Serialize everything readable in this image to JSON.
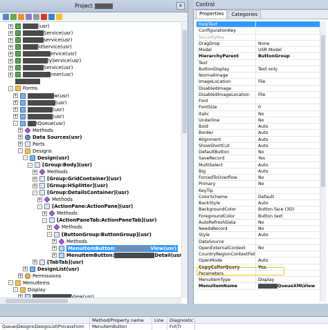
{
  "project_pane": {
    "title": "Project",
    "close_glyph": "x",
    "tree": [
      {
        "indent": 0,
        "exp": "+",
        "icon": "ic-class",
        "text": "(usr)",
        "pre": 22
      },
      {
        "indent": 0,
        "exp": "+",
        "icon": "ic-class",
        "text": "Service(usr)",
        "pre": 30
      },
      {
        "indent": 0,
        "exp": "+",
        "icon": "ic-class",
        "text": "service(usr)",
        "pre": 30
      },
      {
        "indent": 0,
        "exp": "+",
        "icon": "ic-class",
        "text": "ldService(usr)",
        "pre": 22
      },
      {
        "indent": 0,
        "exp": "+",
        "icon": "ic-class",
        "text": "ervice(usr)",
        "pre": 40
      },
      {
        "indent": 0,
        "exp": "+",
        "icon": "ic-class",
        "text": "lyService(usr)",
        "pre": 36
      },
      {
        "indent": 0,
        "exp": "+",
        "icon": "ic-class",
        "text": "Service(usr)",
        "pre": 30
      },
      {
        "indent": 0,
        "exp": "+",
        "icon": "ic-class",
        "text": "nner(usr)",
        "pre": 40
      },
      {
        "indent": 0,
        "exp": "",
        "icon": "",
        "text": "",
        "pre": 36
      },
      {
        "indent": 0,
        "exp": "-",
        "icon": "ic-folder",
        "text": "Forms",
        "pre": 0
      },
      {
        "indent": 1,
        "exp": "+",
        "icon": "ic-form",
        "text": "w(usr)",
        "pre": 38
      },
      {
        "indent": 1,
        "exp": "+",
        "icon": "ic-form",
        "text": "(usr)",
        "pre": 40
      },
      {
        "indent": 1,
        "exp": "+",
        "icon": "ic-form",
        "text": "(usr)",
        "pre": 36
      },
      {
        "indent": 1,
        "exp": "+",
        "icon": "ic-form",
        "text": "(usr)",
        "pre": 36
      },
      {
        "indent": 1,
        "exp": "-",
        "icon": "ic-form",
        "text": "tQueue(usr)",
        "pre": 12
      },
      {
        "indent": 2,
        "exp": "+",
        "icon": "ic-method",
        "text": "Methods",
        "pre": 0
      },
      {
        "indent": 2,
        "exp": "+",
        "icon": "ic-ds",
        "text": "Data Sources(usr)",
        "pre": 0,
        "bold": true
      },
      {
        "indent": 2,
        "exp": "+",
        "icon": "ic-group",
        "text": "Parts",
        "pre": 0
      },
      {
        "indent": 2,
        "exp": "-",
        "icon": "ic-folder",
        "text": "Designs",
        "pre": 0
      },
      {
        "indent": 3,
        "exp": "-",
        "icon": "ic-form",
        "text": "Design(usr)",
        "pre": 0,
        "bold": true
      },
      {
        "indent": 4,
        "exp": "-",
        "icon": "ic-group",
        "text": "[Group:Body](usr)",
        "pre": 0,
        "bold": true
      },
      {
        "indent": 5,
        "exp": "+",
        "icon": "ic-method",
        "text": "Methods",
        "pre": 0
      },
      {
        "indent": 5,
        "exp": "+",
        "icon": "ic-group",
        "text": "[Group:GridContainer](usr)",
        "pre": 0,
        "bold": true
      },
      {
        "indent": 5,
        "exp": "+",
        "icon": "ic-group",
        "text": "[Group:HSplitter](usr)",
        "pre": 0,
        "bold": true
      },
      {
        "indent": 5,
        "exp": "-",
        "icon": "ic-group",
        "text": "[Group:DetailsContainer](usr)",
        "pre": 0,
        "bold": true
      },
      {
        "indent": 6,
        "exp": "+",
        "icon": "ic-method",
        "text": "Methods",
        "pre": 0
      },
      {
        "indent": 6,
        "exp": "-",
        "icon": "ic-group",
        "text": "[ActionPane:ActionPane](usr)",
        "pre": 0,
        "bold": true
      },
      {
        "indent": 7,
        "exp": "+",
        "icon": "ic-method",
        "text": "Methods",
        "pre": 0
      },
      {
        "indent": 7,
        "exp": "-",
        "icon": "ic-group",
        "text": "[ActionPaneTab:ActionPaneTab](usr)",
        "pre": 0,
        "bold": true
      },
      {
        "indent": 8,
        "exp": "+",
        "icon": "ic-method",
        "text": "Methods",
        "pre": 0
      },
      {
        "indent": 8,
        "exp": "-",
        "icon": "ic-group",
        "text": "[ButtonGroup:ButtonGroup](usr)",
        "pre": 0,
        "bold": true
      },
      {
        "indent": 9,
        "exp": "+",
        "icon": "ic-method",
        "text": "Methods",
        "pre": 0
      },
      {
        "indent": 9,
        "exp": "+",
        "icon": "ic-button",
        "text": "MenuItemButton:",
        "post": "View(usr)",
        "redact": 50,
        "pre": 0,
        "bold": true,
        "selected": true
      },
      {
        "indent": 9,
        "exp": "+",
        "icon": "ic-button",
        "text": "MenuItemButton:",
        "post": "Detail(usr)",
        "redact": 58,
        "pre": 0,
        "bold": true
      },
      {
        "indent": 5,
        "exp": "+",
        "icon": "ic-group",
        "text": "[TabTab](usr)",
        "pre": 0,
        "bold": true
      },
      {
        "indent": 3,
        "exp": "+",
        "icon": "ic-form",
        "text": "DesignList(usr)",
        "pre": 0,
        "bold": true
      },
      {
        "indent": 2,
        "exp": "+",
        "icon": "ic-perm",
        "text": "Permissions",
        "pre": 0
      },
      {
        "indent": 0,
        "exp": "-",
        "icon": "ic-folder",
        "text": "MenuItems",
        "pre": 0
      },
      {
        "indent": 1,
        "exp": "-",
        "icon": "ic-folder",
        "text": "Display",
        "pre": 0
      },
      {
        "indent": 2,
        "exp": "+",
        "icon": "ic-button",
        "text": "View(usr)",
        "pre": 56
      }
    ]
  },
  "control_pane": {
    "title": "Control",
    "tabs": [
      "Properties",
      "Categories"
    ],
    "properties": [
      {
        "name": "HelpText",
        "value": "",
        "hl": true
      },
      {
        "name": "ConfigurationKey",
        "value": ""
      },
      {
        "name": "SecurityKey",
        "value": "",
        "gray": true
      },
      {
        "name": "DragDrop",
        "value": "None"
      },
      {
        "name": "Model",
        "value": "USR Model"
      },
      {
        "name": "HierarchyParent",
        "value": "ButtonGroup",
        "bold": true
      },
      {
        "name": "Text",
        "value": ""
      },
      {
        "name": "ButtonDisplay",
        "value": "Text only"
      },
      {
        "name": "NormalImage",
        "value": ""
      },
      {
        "name": "ImageLocation",
        "value": "File"
      },
      {
        "name": "DisabledImage",
        "value": ""
      },
      {
        "name": "DisabledImageLocation",
        "value": "File"
      },
      {
        "name": "Font",
        "value": ""
      },
      {
        "name": "FontSize",
        "value": "0"
      },
      {
        "name": "Italic",
        "value": "No"
      },
      {
        "name": "Underline",
        "value": "No"
      },
      {
        "name": "Bold",
        "value": "Auto"
      },
      {
        "name": "Border",
        "value": "Auto"
      },
      {
        "name": "Alignment",
        "value": "Auto"
      },
      {
        "name": "ShowShortCut",
        "value": "Auto"
      },
      {
        "name": "DefaultButton",
        "value": "No"
      },
      {
        "name": "SaveRecord",
        "value": "Yes"
      },
      {
        "name": "MultiSelect",
        "value": "Auto"
      },
      {
        "name": "Big",
        "value": "Auto"
      },
      {
        "name": "ForcedToOverflow",
        "value": "No"
      },
      {
        "name": "Primary",
        "value": "No"
      },
      {
        "name": "KeyTip",
        "value": ""
      },
      {
        "name": "ColorScheme",
        "value": "Default"
      },
      {
        "name": "BackStyle",
        "value": "Auto"
      },
      {
        "name": "BackgroundColor",
        "value": "Button face (3D)"
      },
      {
        "name": "ForegroundColor",
        "value": "Button text"
      },
      {
        "name": "AutoRefreshData",
        "value": "No"
      },
      {
        "name": "NeedsRecord",
        "value": "No"
      },
      {
        "name": "Style",
        "value": "Auto"
      },
      {
        "name": "DataSource",
        "value": ""
      },
      {
        "name": "OpenExternalContext",
        "value": "No"
      },
      {
        "name": "CountryRegionContextField",
        "value": ""
      },
      {
        "name": "OpenMode",
        "value": "Auto"
      },
      {
        "name": "CopyCallerQuery",
        "value": "Yes",
        "bold": true
      },
      {
        "name": "Parameters",
        "value": ""
      },
      {
        "name": "MenuItemType",
        "value": "Display"
      },
      {
        "name": "MenuItemName",
        "value": "QueueXMLView",
        "bold": true,
        "redact": true
      }
    ]
  },
  "bottom_pane": {
    "columns": [
      "",
      "Method/Property name",
      "Line",
      "Diagnostic"
    ],
    "row": [
      "Queue\\Designs\\DesignList\\ProcessForm",
      "MenuItemButton",
      "",
      "Fnl\\TI"
    ]
  }
}
